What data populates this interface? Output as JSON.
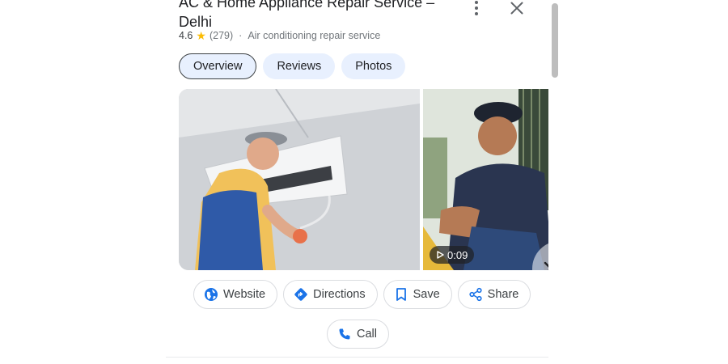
{
  "place": {
    "title_line1": "AC & Home Appliance Repair Service –",
    "title_line2": "Delhi",
    "rating": "4.6",
    "review_count": "(279)",
    "separator": "·",
    "category": "Air conditioning repair service"
  },
  "header_icons": {
    "more": "more-vert-icon",
    "close": "close-icon"
  },
  "tabs": [
    {
      "label": "Overview",
      "active": true
    },
    {
      "label": "Reviews",
      "active": false
    },
    {
      "label": "Photos",
      "active": false
    }
  ],
  "media": {
    "photos": [
      {
        "kind": "image",
        "subject": "technician installing wall air conditioner"
      },
      {
        "kind": "video",
        "subject": "technician repairing outdoor AC unit",
        "duration": "0:09"
      }
    ],
    "next_icon": "chevron-right-icon"
  },
  "actions": [
    {
      "label": "Website",
      "icon": "globe-icon"
    },
    {
      "label": "Directions",
      "icon": "directions-icon"
    },
    {
      "label": "Save",
      "icon": "bookmark-icon"
    },
    {
      "label": "Share",
      "icon": "share-icon"
    },
    {
      "label": "Call",
      "icon": "phone-icon"
    }
  ],
  "colors": {
    "accent": "#1a73e8",
    "tab_bg": "#e8f0fe",
    "star": "#fbbc04"
  }
}
